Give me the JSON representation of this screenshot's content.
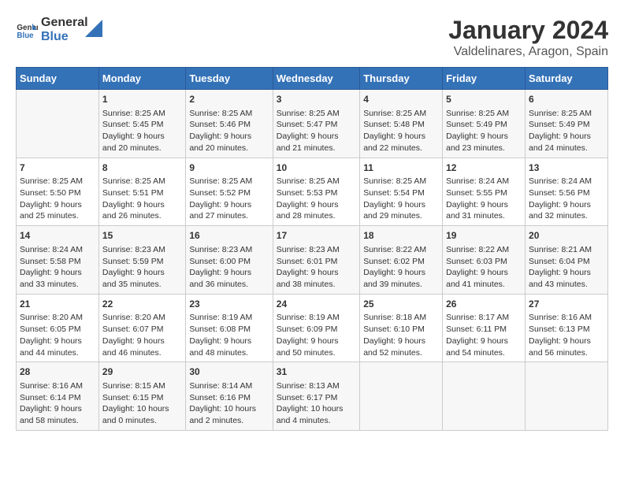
{
  "logo": {
    "text_general": "General",
    "text_blue": "Blue"
  },
  "title": "January 2024",
  "subtitle": "Valdelinares, Aragon, Spain",
  "days_of_week": [
    "Sunday",
    "Monday",
    "Tuesday",
    "Wednesday",
    "Thursday",
    "Friday",
    "Saturday"
  ],
  "weeks": [
    [
      {
        "day": "",
        "content": ""
      },
      {
        "day": "1",
        "content": "Sunrise: 8:25 AM\nSunset: 5:45 PM\nDaylight: 9 hours\nand 20 minutes."
      },
      {
        "day": "2",
        "content": "Sunrise: 8:25 AM\nSunset: 5:46 PM\nDaylight: 9 hours\nand 20 minutes."
      },
      {
        "day": "3",
        "content": "Sunrise: 8:25 AM\nSunset: 5:47 PM\nDaylight: 9 hours\nand 21 minutes."
      },
      {
        "day": "4",
        "content": "Sunrise: 8:25 AM\nSunset: 5:48 PM\nDaylight: 9 hours\nand 22 minutes."
      },
      {
        "day": "5",
        "content": "Sunrise: 8:25 AM\nSunset: 5:49 PM\nDaylight: 9 hours\nand 23 minutes."
      },
      {
        "day": "6",
        "content": "Sunrise: 8:25 AM\nSunset: 5:49 PM\nDaylight: 9 hours\nand 24 minutes."
      }
    ],
    [
      {
        "day": "7",
        "content": "Sunrise: 8:25 AM\nSunset: 5:50 PM\nDaylight: 9 hours\nand 25 minutes."
      },
      {
        "day": "8",
        "content": "Sunrise: 8:25 AM\nSunset: 5:51 PM\nDaylight: 9 hours\nand 26 minutes."
      },
      {
        "day": "9",
        "content": "Sunrise: 8:25 AM\nSunset: 5:52 PM\nDaylight: 9 hours\nand 27 minutes."
      },
      {
        "day": "10",
        "content": "Sunrise: 8:25 AM\nSunset: 5:53 PM\nDaylight: 9 hours\nand 28 minutes."
      },
      {
        "day": "11",
        "content": "Sunrise: 8:25 AM\nSunset: 5:54 PM\nDaylight: 9 hours\nand 29 minutes."
      },
      {
        "day": "12",
        "content": "Sunrise: 8:24 AM\nSunset: 5:55 PM\nDaylight: 9 hours\nand 31 minutes."
      },
      {
        "day": "13",
        "content": "Sunrise: 8:24 AM\nSunset: 5:56 PM\nDaylight: 9 hours\nand 32 minutes."
      }
    ],
    [
      {
        "day": "14",
        "content": "Sunrise: 8:24 AM\nSunset: 5:58 PM\nDaylight: 9 hours\nand 33 minutes."
      },
      {
        "day": "15",
        "content": "Sunrise: 8:23 AM\nSunset: 5:59 PM\nDaylight: 9 hours\nand 35 minutes."
      },
      {
        "day": "16",
        "content": "Sunrise: 8:23 AM\nSunset: 6:00 PM\nDaylight: 9 hours\nand 36 minutes."
      },
      {
        "day": "17",
        "content": "Sunrise: 8:23 AM\nSunset: 6:01 PM\nDaylight: 9 hours\nand 38 minutes."
      },
      {
        "day": "18",
        "content": "Sunrise: 8:22 AM\nSunset: 6:02 PM\nDaylight: 9 hours\nand 39 minutes."
      },
      {
        "day": "19",
        "content": "Sunrise: 8:22 AM\nSunset: 6:03 PM\nDaylight: 9 hours\nand 41 minutes."
      },
      {
        "day": "20",
        "content": "Sunrise: 8:21 AM\nSunset: 6:04 PM\nDaylight: 9 hours\nand 43 minutes."
      }
    ],
    [
      {
        "day": "21",
        "content": "Sunrise: 8:20 AM\nSunset: 6:05 PM\nDaylight: 9 hours\nand 44 minutes."
      },
      {
        "day": "22",
        "content": "Sunrise: 8:20 AM\nSunset: 6:07 PM\nDaylight: 9 hours\nand 46 minutes."
      },
      {
        "day": "23",
        "content": "Sunrise: 8:19 AM\nSunset: 6:08 PM\nDaylight: 9 hours\nand 48 minutes."
      },
      {
        "day": "24",
        "content": "Sunrise: 8:19 AM\nSunset: 6:09 PM\nDaylight: 9 hours\nand 50 minutes."
      },
      {
        "day": "25",
        "content": "Sunrise: 8:18 AM\nSunset: 6:10 PM\nDaylight: 9 hours\nand 52 minutes."
      },
      {
        "day": "26",
        "content": "Sunrise: 8:17 AM\nSunset: 6:11 PM\nDaylight: 9 hours\nand 54 minutes."
      },
      {
        "day": "27",
        "content": "Sunrise: 8:16 AM\nSunset: 6:13 PM\nDaylight: 9 hours\nand 56 minutes."
      }
    ],
    [
      {
        "day": "28",
        "content": "Sunrise: 8:16 AM\nSunset: 6:14 PM\nDaylight: 9 hours\nand 58 minutes."
      },
      {
        "day": "29",
        "content": "Sunrise: 8:15 AM\nSunset: 6:15 PM\nDaylight: 10 hours\nand 0 minutes."
      },
      {
        "day": "30",
        "content": "Sunrise: 8:14 AM\nSunset: 6:16 PM\nDaylight: 10 hours\nand 2 minutes."
      },
      {
        "day": "31",
        "content": "Sunrise: 8:13 AM\nSunset: 6:17 PM\nDaylight: 10 hours\nand 4 minutes."
      },
      {
        "day": "",
        "content": ""
      },
      {
        "day": "",
        "content": ""
      },
      {
        "day": "",
        "content": ""
      }
    ]
  ]
}
